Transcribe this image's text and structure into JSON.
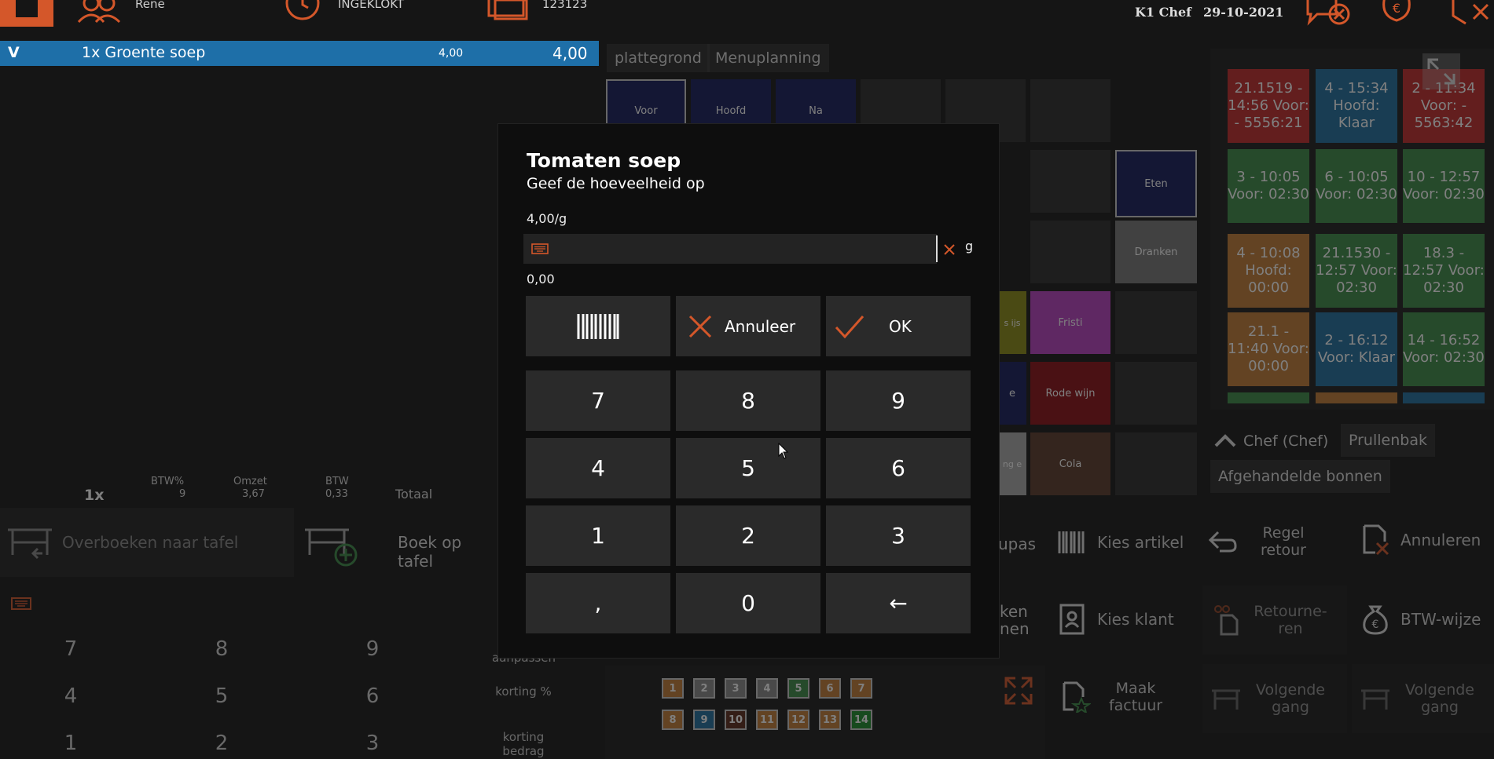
{
  "topbar": {
    "user": "Rene",
    "clock_status": "INGEKLOKT",
    "register_id": "123123",
    "station": "K1 Chef",
    "date": "29-10-2021"
  },
  "order": {
    "rows": [
      {
        "flag": "V",
        "label": "1x Groente soep",
        "unit_price": "4,00",
        "total": "4,00"
      }
    ],
    "summary": {
      "qty": "1x",
      "btw_pct_label": "BTW%",
      "btw_pct": "9",
      "omzet_label": "Omzet",
      "omzet": "3,67",
      "btw_label": "BTW",
      "btw": "0,33",
      "total_label": "Totaal"
    }
  },
  "tabs": [
    "plattegrond",
    "Menuplanning"
  ],
  "tiles": {
    "voor": "Voor",
    "hoofd": "Hoofd",
    "na": "Na",
    "eten": "Eten",
    "dranken": "Dranken",
    "ijs": "s ijs",
    "fristi": "Fristi",
    "e": "e",
    "rode_wijn": "Rode wijn",
    "ng": "ng e",
    "cola": "Cola"
  },
  "cards": [
    {
      "text": "21.1519 - 14:56 Voor: - 5556:21",
      "color": "red"
    },
    {
      "text": "4 - 15:34 Hoofd: Klaar",
      "color": "blue"
    },
    {
      "text": "2 - 11:34 Voor: - 5563:42",
      "color": "red"
    },
    {
      "text": "3 - 10:05 Voor: 02:30",
      "color": "green"
    },
    {
      "text": "6 - 10:05 Voor: 02:30",
      "color": "green"
    },
    {
      "text": "10 - 12:57 Voor: 02:30",
      "color": "green"
    },
    {
      "text": "4 - 10:08 Hoofd: 00:00",
      "color": "orange"
    },
    {
      "text": "21.1530 - 12:57 Voor: 02:30",
      "color": "green"
    },
    {
      "text": "18.3 - 12:57 Voor: 02:30",
      "color": "green"
    },
    {
      "text": "21.1 - 11:40 Voor: 00:00",
      "color": "orange"
    },
    {
      "text": "2 - 16:12 Voor: Klaar",
      "color": "blue"
    },
    {
      "text": "14 - 16:52 Voor: 02:30",
      "color": "green"
    }
  ],
  "card_actions": {
    "chef": "Chef (Chef)",
    "trash": "Prullenbak",
    "handled": "Afgehandelde bonnen"
  },
  "actions": {
    "transfer": "Overboeken naar tafel",
    "book": "Boek op tafel",
    "pas": "upas",
    "choose_article": "Kies artikel",
    "return_line": "Regel retour",
    "cancel": "Annuleren",
    "ken": "ken nen",
    "choose_client": "Kies klant",
    "refund": "Retourne-ren",
    "vat_mode": "BTW-wijze",
    "invoice": "Maak factuur",
    "next_course1": "Volgende gang",
    "next_course2": "Volgende gang",
    "adjust": "aanpassen",
    "discount_pct": "korting %",
    "discount_amount": "korting bedrag"
  },
  "bg_keypad": [
    "7",
    "8",
    "9",
    "4",
    "5",
    "6",
    "1",
    "2",
    "3"
  ],
  "mini_tables": [
    "1",
    "2",
    "3",
    "4",
    "5",
    "6",
    "7",
    "8",
    "9",
    "10",
    "11",
    "12",
    "13",
    "14"
  ],
  "modal": {
    "title": "Tomaten soep",
    "subtitle": "Geef de hoeveelheid op",
    "price_per_unit": "4,00/g",
    "input_value": "",
    "unit": "g",
    "total": "0,00",
    "cancel_label": "Annuleer",
    "ok_label": "OK",
    "keys": [
      "7",
      "8",
      "9",
      "4",
      "5",
      "6",
      "1",
      "2",
      "3",
      ",",
      "0",
      "←"
    ]
  }
}
